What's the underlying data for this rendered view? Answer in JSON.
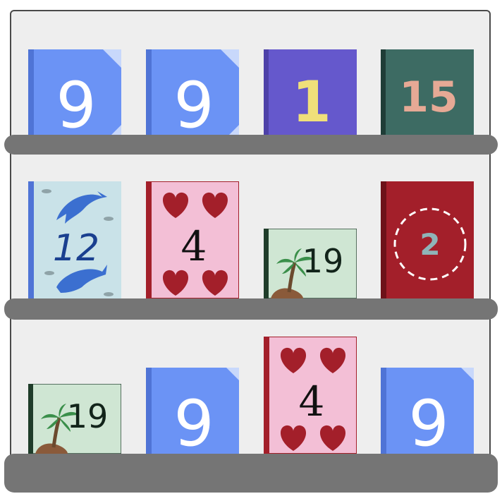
{
  "colors": {
    "case_bg": "#eeeeee",
    "case_border": "#4a4a4a",
    "shelf": "#757575",
    "blue_cover": "#6b93f5",
    "purple_cover": "#6558cc",
    "teal_cover": "#3d6b63",
    "red_cover": "#a31f2a",
    "pink_cover": "#f3bfd6",
    "mint_cover": "#cfe6d3",
    "dolphin_cover": "#c9e2e8"
  },
  "shelves": [
    {
      "books": [
        {
          "number": "9",
          "style": "blue-folded"
        },
        {
          "number": "9",
          "style": "blue-folded"
        },
        {
          "number": "1",
          "style": "purple"
        },
        {
          "number": "15",
          "style": "teal"
        }
      ]
    },
    {
      "books": [
        {
          "number": "12",
          "style": "dolphins"
        },
        {
          "number": "4",
          "style": "hearts"
        },
        {
          "number": "19",
          "style": "palm"
        },
        {
          "number": "2",
          "style": "red-circle"
        }
      ]
    },
    {
      "books": [
        {
          "number": "19",
          "style": "palm"
        },
        {
          "number": "9",
          "style": "blue-folded"
        },
        {
          "number": "4",
          "style": "hearts"
        },
        {
          "number": "9",
          "style": "blue-folded"
        }
      ]
    }
  ]
}
